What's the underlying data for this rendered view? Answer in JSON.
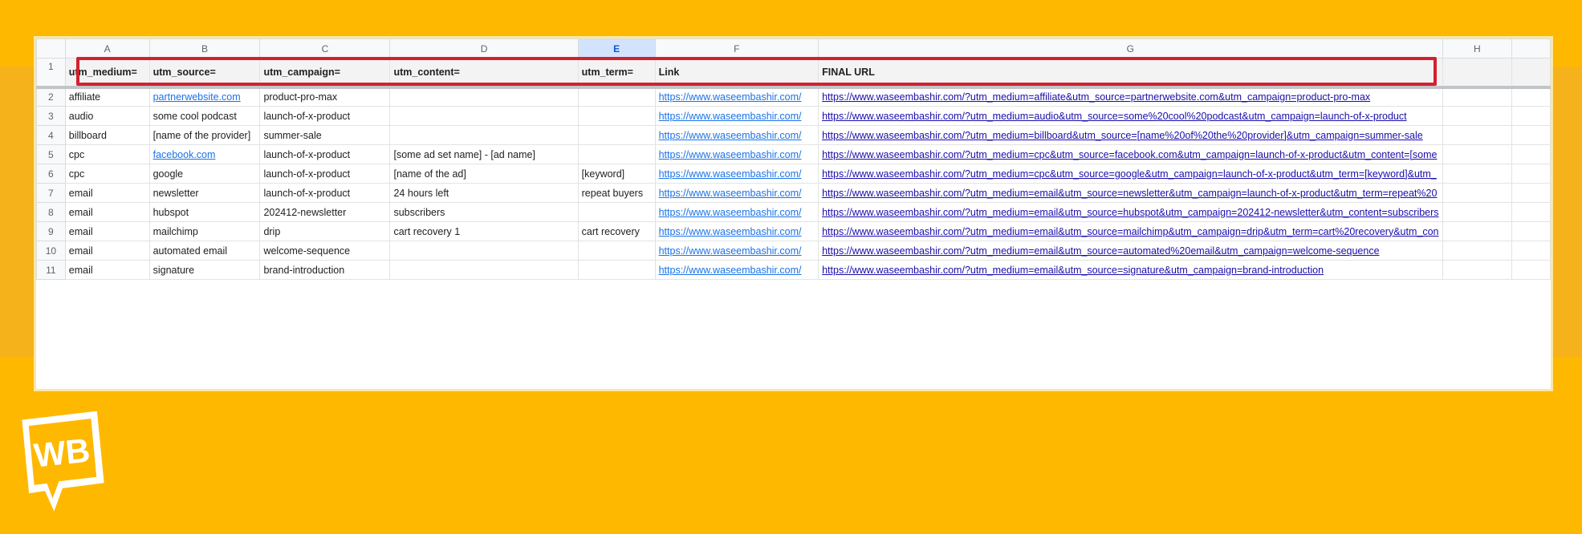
{
  "colors": {
    "background": "#FFB800",
    "highlight": "#d32030",
    "link": "#1a73e8"
  },
  "sheet": {
    "column_letters": [
      "A",
      "B",
      "C",
      "D",
      "E",
      "F",
      "G",
      "H"
    ],
    "selected_column": "E",
    "header_row_number": "1",
    "headers": [
      "utm_medium=",
      "utm_source=",
      "utm_campaign=",
      "utm_content=",
      "utm_term=",
      "Link",
      "FINAL URL",
      ""
    ],
    "rows": [
      {
        "num": "2",
        "medium": "affiliate",
        "source": "partnerwebsite.com",
        "campaign": "product-pro-max",
        "content": "",
        "term": "",
        "link": "https://www.waseembashir.com/",
        "final": "https://www.waseembashir.com/?utm_medium=affiliate&utm_source=partnerwebsite.com&utm_campaign=product-pro-max"
      },
      {
        "num": "3",
        "medium": "audio",
        "source": "some cool podcast",
        "campaign": "launch-of-x-product",
        "content": "",
        "term": "",
        "link": "https://www.waseembashir.com/",
        "final": "https://www.waseembashir.com/?utm_medium=audio&utm_source=some%20cool%20podcast&utm_campaign=launch-of-x-product"
      },
      {
        "num": "4",
        "medium": "billboard",
        "source": "[name of the provider]",
        "campaign": "summer-sale",
        "content": "",
        "term": "",
        "link": "https://www.waseembashir.com/",
        "final": "https://www.waseembashir.com/?utm_medium=billboard&utm_source=[name%20of%20the%20provider]&utm_campaign=summer-sale"
      },
      {
        "num": "5",
        "medium": "cpc",
        "source": "facebook.com",
        "campaign": "launch-of-x-product",
        "content": "[some ad set name] - [ad name]",
        "term": "",
        "link": "https://www.waseembashir.com/",
        "final": "https://www.waseembashir.com/?utm_medium=cpc&utm_source=facebook.com&utm_campaign=launch-of-x-product&utm_content=[some"
      },
      {
        "num": "6",
        "medium": "cpc",
        "source": "google",
        "campaign": "launch-of-x-product",
        "content": "[name of the ad]",
        "term": "[keyword]",
        "link": "https://www.waseembashir.com/",
        "final": "https://www.waseembashir.com/?utm_medium=cpc&utm_source=google&utm_campaign=launch-of-x-product&utm_term=[keyword]&utm_"
      },
      {
        "num": "7",
        "medium": "email",
        "source": "newsletter",
        "campaign": "launch-of-x-product",
        "content": "24 hours left",
        "term": "repeat buyers",
        "link": "https://www.waseembashir.com/",
        "final": "https://www.waseembashir.com/?utm_medium=email&utm_source=newsletter&utm_campaign=launch-of-x-product&utm_term=repeat%20"
      },
      {
        "num": "8",
        "medium": "email",
        "source": "hubspot",
        "campaign": "202412-newsletter",
        "content": "subscribers",
        "term": "",
        "link": "https://www.waseembashir.com/",
        "final": "https://www.waseembashir.com/?utm_medium=email&utm_source=hubspot&utm_campaign=202412-newsletter&utm_content=subscribers"
      },
      {
        "num": "9",
        "medium": "email",
        "source": "mailchimp",
        "campaign": "drip",
        "content": "cart recovery 1",
        "term": "cart recovery",
        "link": "https://www.waseembashir.com/",
        "final": "https://www.waseembashir.com/?utm_medium=email&utm_source=mailchimp&utm_campaign=drip&utm_term=cart%20recovery&utm_con"
      },
      {
        "num": "10",
        "medium": "email",
        "source": "automated email",
        "campaign": "welcome-sequence",
        "content": "",
        "term": "",
        "link": "https://www.waseembashir.com/",
        "final": "https://www.waseembashir.com/?utm_medium=email&utm_source=automated%20email&utm_campaign=welcome-sequence"
      },
      {
        "num": "11",
        "medium": "email",
        "source": "signature",
        "campaign": "brand-introduction",
        "content": "",
        "term": "",
        "link": "https://www.waseembashir.com/",
        "final": "https://www.waseembashir.com/?utm_medium=email&utm_source=signature&utm_campaign=brand-introduction"
      }
    ]
  },
  "logo": {
    "text": "WB"
  }
}
